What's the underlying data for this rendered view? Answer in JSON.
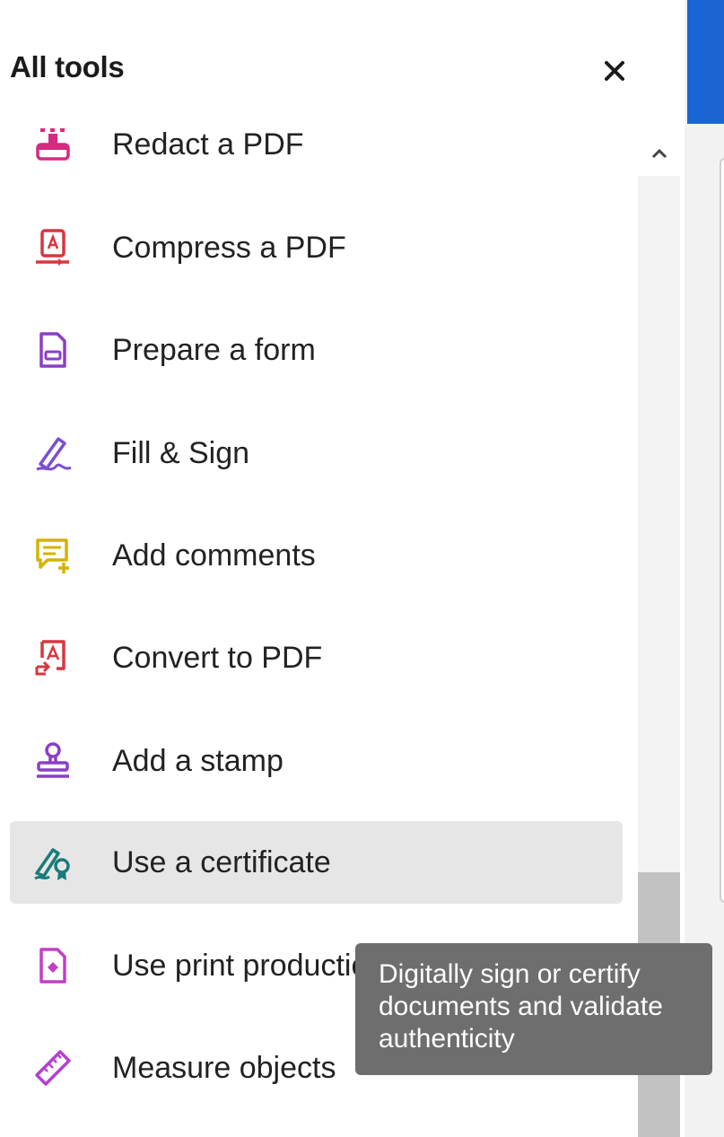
{
  "panel": {
    "title": "All tools",
    "close_icon": "close-icon"
  },
  "tools": [
    {
      "label": "Redact a PDF",
      "icon": "redact-icon",
      "color": "#d42b82"
    },
    {
      "label": "Compress a PDF",
      "icon": "compress-icon",
      "color": "#d7373f"
    },
    {
      "label": "Prepare a form",
      "icon": "form-icon",
      "color": "#8a3fc4"
    },
    {
      "label": "Fill & Sign",
      "icon": "fill-sign-icon",
      "color": "#7a4fd0"
    },
    {
      "label": "Add comments",
      "icon": "comment-icon",
      "color": "#d4b300"
    },
    {
      "label": "Convert to PDF",
      "icon": "convert-icon",
      "color": "#d7373f"
    },
    {
      "label": "Add a stamp",
      "icon": "stamp-icon",
      "color": "#8a3fc4"
    },
    {
      "label": "Use a certificate",
      "icon": "certificate-icon",
      "color": "#1b7a7a"
    },
    {
      "label": "Use print production",
      "icon": "print-production-icon",
      "color": "#c23fc4"
    },
    {
      "label": "Measure objects",
      "icon": "ruler-icon",
      "color": "#b53fd0"
    }
  ],
  "hovered_tool": "Use a certificate",
  "tooltip": {
    "line1": "Digitally sign or certify",
    "line2": "documents and validate",
    "line3": "authenticity"
  },
  "colors": {
    "accent_blue": "#1a64d4",
    "hover_bg": "#e6e6e6",
    "tooltip_bg": "#6e6e6e"
  }
}
